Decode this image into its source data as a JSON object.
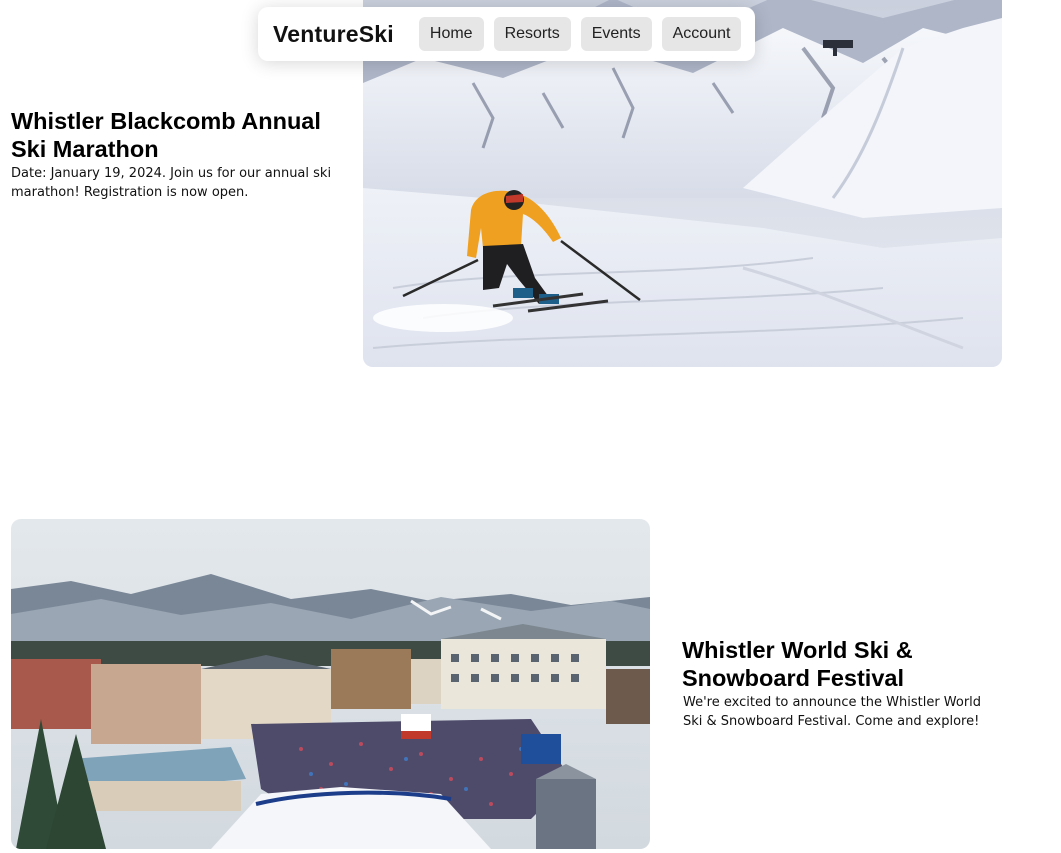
{
  "nav": {
    "brand": "VentureSki",
    "items": [
      {
        "label": "Home"
      },
      {
        "label": "Resorts"
      },
      {
        "label": "Events"
      },
      {
        "label": "Account"
      }
    ]
  },
  "events": [
    {
      "title_line1": "Whistler Blackcomb Annual",
      "title_line2": "Ski Marathon",
      "desc_line1": "Date: January 19, 2024. Join us for our annual ski",
      "desc_line2": "marathon! Registration is now open.",
      "image": "skier-on-snowy-slope-photo"
    },
    {
      "title_line1": "Whistler World Ski &",
      "title_line2": "Snowboard Festival",
      "desc_line1": "We're excited to announce the Whistler World",
      "desc_line2": "Ski & Snowboard Festival. Come and explore!",
      "image": "ski-village-festival-crowd-photo"
    }
  ],
  "colors": {
    "nav_button_bg": "#e6e6e6",
    "jacket": "#f0a020",
    "snow": "#f2f4f8",
    "sky": "#dfe4e8"
  }
}
